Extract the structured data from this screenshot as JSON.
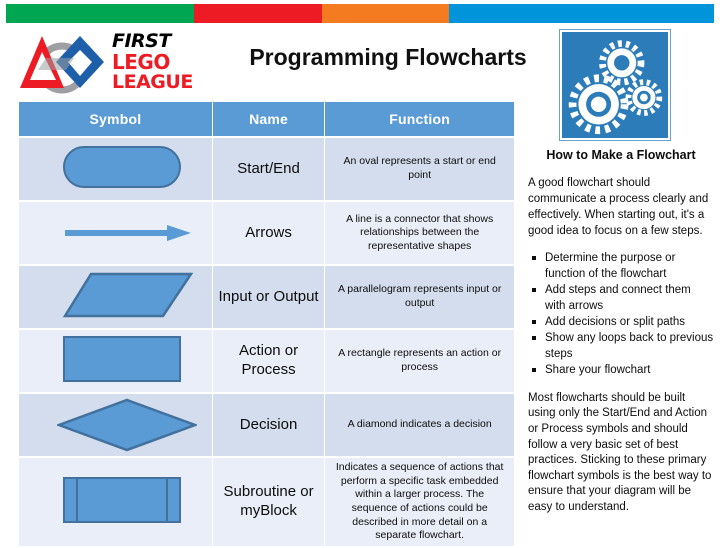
{
  "colorbar": {
    "bands": [
      {
        "name": "green",
        "color": "#00a651"
      },
      {
        "name": "red",
        "color": "#ed1c24"
      },
      {
        "name": "orange",
        "color": "#f47b20"
      },
      {
        "name": "blue",
        "color": "#0095da"
      }
    ]
  },
  "logo": {
    "first": "FIRST",
    "lego": "LEGO",
    "league": "LEAGUE"
  },
  "header": {
    "title": "Programming Flowcharts"
  },
  "table": {
    "headers": {
      "symbol": "Symbol",
      "name": "Name",
      "function": "Function"
    },
    "rows": [
      {
        "symbol": "oval",
        "name": "Start/End",
        "function": "An oval represents a start or end point"
      },
      {
        "symbol": "arrow",
        "name": "Arrows",
        "function": "A line is a connector that shows relationships between the representative shapes"
      },
      {
        "symbol": "parallelogram",
        "name": "Input or Output",
        "function": "A parallelogram represents input or output"
      },
      {
        "symbol": "rectangle",
        "name": "Action or Process",
        "function": "A rectangle represents an action or process"
      },
      {
        "symbol": "diamond",
        "name": "Decision",
        "function": "A diamond indicates a decision"
      },
      {
        "symbol": "subroutine",
        "name": "Subroutine or myBlock",
        "function": "Indicates a sequence of actions that perform a specific task embedded within a larger process. The sequence of actions could be described in more detail on a separate flowchart."
      }
    ]
  },
  "panel": {
    "heading": "How to Make a Flowchart",
    "intro": "A good flowchart should communicate a process clearly and effectively.  When starting out, it's a good idea to focus on a few steps.",
    "steps": [
      "Determine the purpose or function of the flowchart",
      "Add steps and connect them with arrows",
      "Add decisions or split paths",
      "Show any loops back to previous steps",
      "Share your flowchart"
    ],
    "closing": "Most flowcharts should be built using only the Start/End and Action or Process symbols and should follow a very basic set of best practices.  Sticking to these primary flowchart symbols is the best way to ensure that your diagram will be easy to understand."
  },
  "colors": {
    "header_blue": "#5b9bd5",
    "shape_fill": "#5b9bd5",
    "shape_stroke": "#41719c",
    "row_odd": "#d4ddee",
    "row_even": "#e9eef8",
    "gears_blue": "#2b7cb9"
  }
}
